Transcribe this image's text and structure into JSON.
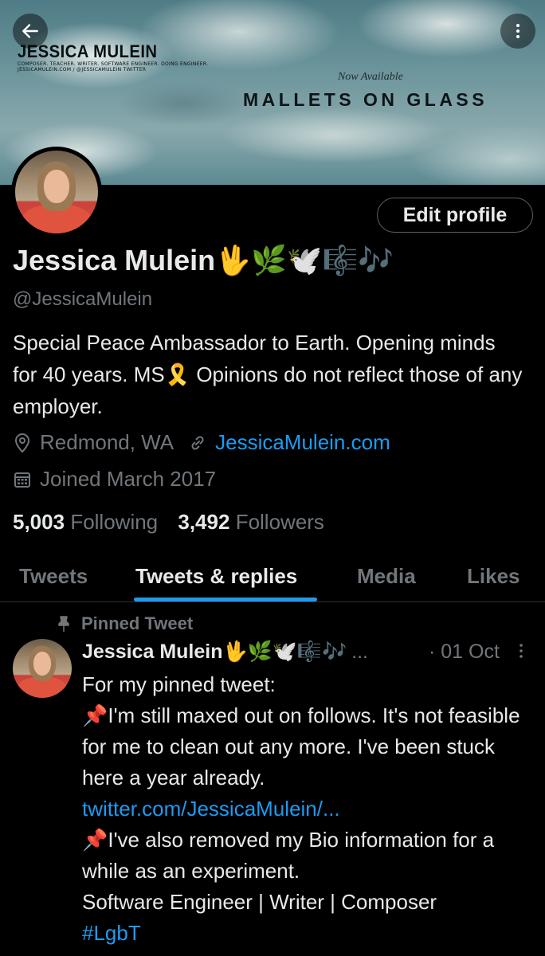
{
  "banner": {
    "brand_name": "JESSICA MULEIN",
    "brand_sub1": "COMPOSER. TEACHER. WRITER. SOFTWARE ENGINEER. DOING ENGINEER.",
    "brand_sub2": "JESSICAMULEIN.COM / @JESSICAMULEIN TWITTER",
    "now_available": "Now Available",
    "album_title": "MALLETS ON GLASS"
  },
  "profile": {
    "edit_label": "Edit profile",
    "display_name": "Jessica Mulein🖖🌿🕊️🎼🎶",
    "handle": "@JessicaMulein",
    "bio": "Special Peace Ambassador to Earth. Opening minds for 40 years. MS🎗️ Opinions do not reflect those of any employer.",
    "location": "Redmond, WA",
    "website": "JessicaMulein.com",
    "joined": "Joined March 2017",
    "following_count": "5,003",
    "following_label": "Following",
    "followers_count": "3,492",
    "followers_label": "Followers"
  },
  "tabs": [
    {
      "label": "Tweets"
    },
    {
      "label": "Tweets & replies"
    },
    {
      "label": "Media"
    },
    {
      "label": "Likes"
    }
  ],
  "pinned": {
    "label": "Pinned Tweet",
    "author_name": "Jessica Mulein🖖🌿🕊️🎼🎶",
    "ellipsis": "...",
    "date": "· 01 Oct",
    "line1": "For my pinned tweet:",
    "para1": "📌I'm still maxed out on follows. It's not feasible for me to clean out any more. I've been stuck here a year already.",
    "link": "twitter.com/JessicaMulein/...",
    "para2": "📌I've also removed my Bio information for a while as an experiment.",
    "line_roles": "Software Engineer | Writer | Composer",
    "hashtag": "#LgbT"
  },
  "colors": {
    "background": "#000000",
    "text": "#e7e9ea",
    "muted": "#71767b",
    "accent": "#1d9bf0",
    "border": "#2f3336"
  },
  "icons": [
    "arrow-left-icon",
    "more-vertical-icon",
    "location-pin-icon",
    "link-icon",
    "calendar-icon",
    "pin-icon",
    "tweet-more-icon"
  ]
}
